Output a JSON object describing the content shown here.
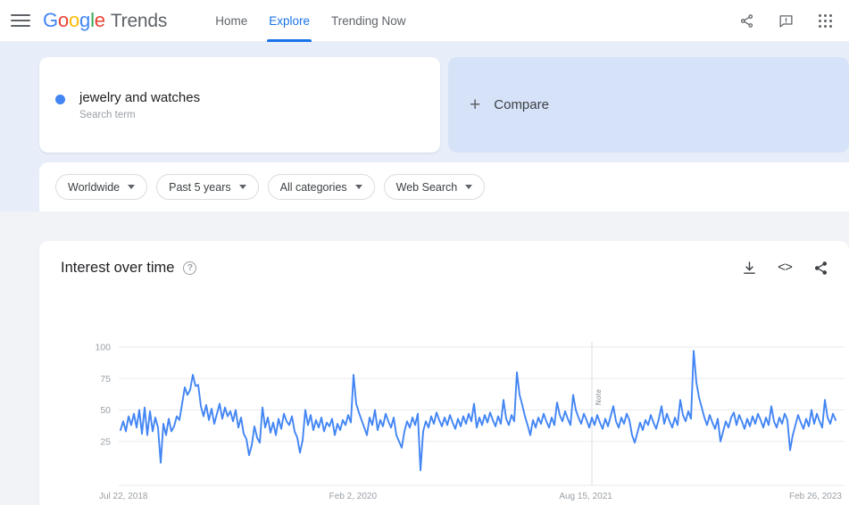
{
  "header": {
    "menu_icon": "hamburger-icon",
    "logo": {
      "g1": "G",
      "o1": "o",
      "o2": "o",
      "g2": "g",
      "l": "l",
      "e": "e",
      "product": "Trends"
    },
    "nav": [
      {
        "label": "Home",
        "active": false
      },
      {
        "label": "Explore",
        "active": true
      },
      {
        "label": "Trending Now",
        "active": false
      }
    ],
    "actions": [
      {
        "name": "share-icon",
        "label": "Share"
      },
      {
        "name": "feedback-icon",
        "label": "Send feedback"
      },
      {
        "name": "apps-grid-icon",
        "label": "Google apps"
      }
    ]
  },
  "search_term_card": {
    "term": "jewelry and watches",
    "subtitle": "Search term",
    "dot_color": "#4285f4"
  },
  "compare_card": {
    "plus": "+",
    "label": "Compare",
    "background": "#d6e2f8"
  },
  "filters": [
    {
      "label": "Worldwide",
      "name": "location-filter"
    },
    {
      "label": "Past 5 years",
      "name": "time-range-filter"
    },
    {
      "label": "All categories",
      "name": "category-filter"
    },
    {
      "label": "Web Search",
      "name": "search-type-filter"
    }
  ],
  "chart_card": {
    "title": "Interest over time",
    "help_glyph": "?",
    "tools": [
      {
        "name": "download-icon",
        "label": "Download CSV"
      },
      {
        "name": "embed-icon",
        "label": "<>"
      },
      {
        "name": "share-icon",
        "label": "Share"
      }
    ],
    "annotation_note": "Note"
  },
  "chart_data": {
    "type": "line",
    "title": "Interest over time",
    "xlabel": "",
    "ylabel": "",
    "ylim": [
      0,
      100
    ],
    "yticks": [
      25,
      50,
      75,
      100
    ],
    "grid": true,
    "legend": [
      "jewelry and watches"
    ],
    "line_color": "#4285f4",
    "x_tick_labels": [
      "Jul 22, 2018",
      "Feb 2, 2020",
      "Aug 15, 2021",
      "Feb 26, 2023"
    ],
    "x_tick_positions": [
      0,
      0.315,
      0.63,
      0.945
    ],
    "series": [
      {
        "name": "jewelry and watches",
        "values": [
          34,
          41,
          33,
          45,
          38,
          47,
          36,
          50,
          31,
          52,
          30,
          49,
          33,
          44,
          36,
          8,
          39,
          30,
          43,
          33,
          37,
          45,
          42,
          55,
          68,
          62,
          66,
          78,
          69,
          70,
          53,
          45,
          54,
          42,
          51,
          39,
          47,
          55,
          43,
          52,
          45,
          49,
          41,
          50,
          36,
          44,
          31,
          27,
          14,
          22,
          37,
          28,
          24,
          52,
          36,
          44,
          32,
          40,
          30,
          43,
          35,
          47,
          41,
          38,
          45,
          33,
          28,
          16,
          26,
          50,
          38,
          46,
          34,
          42,
          36,
          44,
          33,
          40,
          37,
          43,
          30,
          39,
          34,
          42,
          38,
          46,
          40,
          78,
          55,
          48,
          42,
          36,
          30,
          44,
          38,
          50,
          34,
          42,
          37,
          47,
          41,
          36,
          44,
          30,
          25,
          20,
          33,
          41,
          36,
          44,
          38,
          47,
          2,
          33,
          41,
          36,
          45,
          39,
          48,
          42,
          37,
          44,
          38,
          46,
          40,
          35,
          43,
          37,
          45,
          39,
          47,
          41,
          55,
          36,
          44,
          38,
          46,
          40,
          48,
          42,
          37,
          45,
          39,
          58,
          43,
          38,
          46,
          41,
          80,
          62,
          54,
          45,
          38,
          30,
          42,
          36,
          44,
          39,
          47,
          41,
          36,
          44,
          38,
          56,
          46,
          41,
          49,
          43,
          38,
          62,
          50,
          44,
          39,
          47,
          42,
          36,
          44,
          38,
          46,
          40,
          35,
          43,
          37,
          45,
          53,
          41,
          36,
          44,
          39,
          47,
          42,
          30,
          24,
          32,
          40,
          34,
          42,
          38,
          46,
          40,
          35,
          43,
          53,
          39,
          47,
          41,
          36,
          44,
          38,
          58,
          46,
          41,
          49,
          43,
          97,
          72,
          60,
          52,
          44,
          38,
          46,
          40,
          35,
          43,
          25,
          33,
          41,
          36,
          44,
          48,
          38,
          46,
          41,
          35,
          43,
          37,
          45,
          39,
          47,
          42,
          36,
          44,
          38,
          53,
          41,
          36,
          44,
          39,
          47,
          42,
          18,
          30,
          38,
          46,
          40,
          35,
          43,
          37,
          50,
          39,
          47,
          41,
          36,
          58,
          44,
          39,
          47,
          42
        ]
      }
    ]
  }
}
